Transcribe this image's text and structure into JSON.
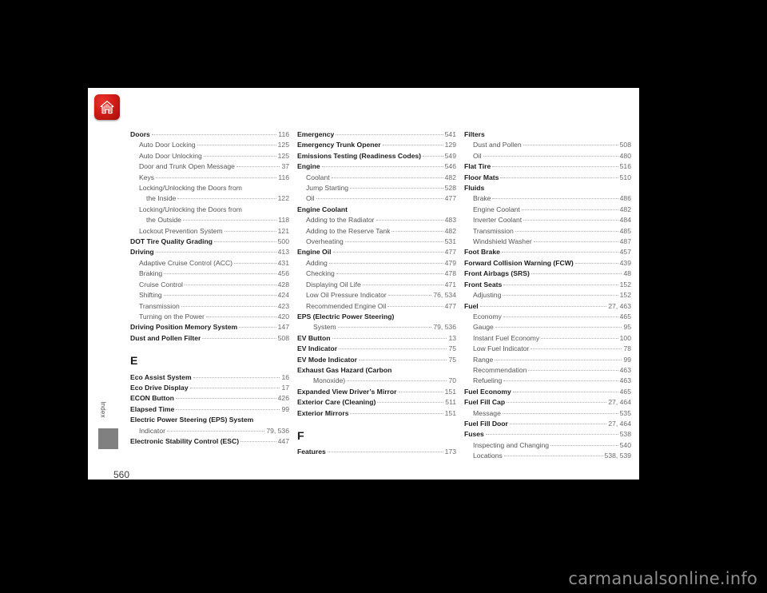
{
  "page": {
    "folio": "560",
    "side_tab_label": "Index",
    "home_icon": "home-icon"
  },
  "watermark": {
    "text": "carmanualsonline.info"
  },
  "columns": [
    {
      "id": "column-1",
      "blocks": [
        {
          "type": "entries",
          "entries": [
            {
              "level": 0,
              "text": "Doors",
              "page": "116"
            },
            {
              "level": 1,
              "text": "Auto Door Locking",
              "page": "125"
            },
            {
              "level": 1,
              "text": "Auto Door Unlocking",
              "page": "125"
            },
            {
              "level": 1,
              "text": "Door and Trunk Open Message",
              "page": "37"
            },
            {
              "level": 1,
              "text": "Keys",
              "page": "116"
            },
            {
              "level": 1,
              "text": "Locking/Unlocking the Doors from",
              "page": ""
            },
            {
              "level": 2,
              "text": "the Inside",
              "page": "122"
            },
            {
              "level": 1,
              "text": "Locking/Unlocking the Doors from",
              "page": ""
            },
            {
              "level": 2,
              "text": "the Outside",
              "page": "118"
            },
            {
              "level": 1,
              "text": "Lockout Prevention System",
              "page": "121"
            },
            {
              "level": 0,
              "text": "DOT Tire Quality Grading",
              "page": "500"
            },
            {
              "level": 0,
              "text": "Driving",
              "page": "413"
            },
            {
              "level": 1,
              "text": "Adaptive Cruise Control (ACC)",
              "page": "431"
            },
            {
              "level": 1,
              "text": "Braking",
              "page": "456"
            },
            {
              "level": 1,
              "text": "Cruise Control",
              "page": "428"
            },
            {
              "level": 1,
              "text": "Shifting",
              "page": "424"
            },
            {
              "level": 1,
              "text": "Transmission",
              "page": "423"
            },
            {
              "level": 1,
              "text": "Turning on the Power",
              "page": "420"
            },
            {
              "level": 0,
              "text": "Driving Position Memory System",
              "page": "147"
            },
            {
              "level": 0,
              "text": "Dust and Pollen Filter",
              "page": "508"
            }
          ]
        },
        {
          "type": "letter",
          "letter": "E",
          "entries": [
            {
              "level": 0,
              "text": "Eco Assist System",
              "page": "16"
            },
            {
              "level": 0,
              "text": "Eco Drive Display",
              "page": "17"
            },
            {
              "level": 0,
              "text": "ECON Button",
              "page": "426"
            },
            {
              "level": 0,
              "text": "Elapsed Time",
              "page": "99"
            },
            {
              "level": 0,
              "text": "Electric Power Steering (EPS) System",
              "page": ""
            },
            {
              "level": 1,
              "text": "Indicator",
              "page": "79, 536"
            },
            {
              "level": 0,
              "text": "Electronic Stability Control (ESC)",
              "page": "447"
            }
          ]
        }
      ]
    },
    {
      "id": "column-2",
      "blocks": [
        {
          "type": "entries",
          "entries": [
            {
              "level": 0,
              "text": "Emergency",
              "page": "541"
            },
            {
              "level": 0,
              "text": "Emergency Trunk Opener",
              "page": "129"
            },
            {
              "level": 0,
              "text": "Emissions Testing (Readiness Codes)",
              "page": "549"
            },
            {
              "level": 0,
              "text": "Engine",
              "page": "546"
            },
            {
              "level": 1,
              "text": "Coolant",
              "page": "482"
            },
            {
              "level": 1,
              "text": "Jump Starting",
              "page": "528"
            },
            {
              "level": 1,
              "text": "Oil",
              "page": "477"
            },
            {
              "level": 0,
              "text": "Engine Coolant",
              "page": ""
            },
            {
              "level": 1,
              "text": "Adding to the Radiator",
              "page": "483"
            },
            {
              "level": 1,
              "text": "Adding to the Reserve Tank",
              "page": "482"
            },
            {
              "level": 1,
              "text": "Overheating",
              "page": "531"
            },
            {
              "level": 0,
              "text": "Engine Oil",
              "page": "477"
            },
            {
              "level": 1,
              "text": "Adding",
              "page": "479"
            },
            {
              "level": 1,
              "text": "Checking",
              "page": "478"
            },
            {
              "level": 1,
              "text": "Displaying Oil Life",
              "page": "471"
            },
            {
              "level": 1,
              "text": "Low Oil Pressure Indicator",
              "page": "76, 534"
            },
            {
              "level": 1,
              "text": "Recommended Engine Oil",
              "page": "477"
            },
            {
              "level": 0,
              "text": "EPS (Electric Power Steering)",
              "page": ""
            },
            {
              "level": 2,
              "text": "System",
              "page": "79, 536"
            },
            {
              "level": 0,
              "text": "EV Button",
              "page": "13"
            },
            {
              "level": 0,
              "text": "EV Indicator",
              "page": "75"
            },
            {
              "level": 0,
              "text": "EV Mode Indicator",
              "page": "75"
            },
            {
              "level": 0,
              "text": "Exhaust Gas Hazard (Carbon",
              "page": ""
            },
            {
              "level": 2,
              "text": "Monoxide)",
              "page": "70"
            },
            {
              "level": 0,
              "text": "Expanded View Driver’s Mirror",
              "page": "151"
            },
            {
              "level": 0,
              "text": "Exterior Care (Cleaning)",
              "page": "511"
            },
            {
              "level": 0,
              "text": "Exterior Mirrors",
              "page": "151"
            }
          ]
        },
        {
          "type": "letter",
          "letter": "F",
          "entries": [
            {
              "level": 0,
              "text": "Features",
              "page": "173"
            }
          ]
        }
      ]
    },
    {
      "id": "column-3",
      "blocks": [
        {
          "type": "entries",
          "entries": [
            {
              "level": 0,
              "text": "Filters",
              "page": ""
            },
            {
              "level": 1,
              "text": "Dust and Pollen",
              "page": "508"
            },
            {
              "level": 1,
              "text": "Oil",
              "page": "480"
            },
            {
              "level": 0,
              "text": "Flat Tire",
              "page": "516"
            },
            {
              "level": 0,
              "text": "Floor Mats",
              "page": "510"
            },
            {
              "level": 0,
              "text": "Fluids",
              "page": ""
            },
            {
              "level": 1,
              "text": "Brake",
              "page": "486"
            },
            {
              "level": 1,
              "text": "Engine Coolant",
              "page": "482"
            },
            {
              "level": 1,
              "text": "Inverter Coolant",
              "page": "484"
            },
            {
              "level": 1,
              "text": "Transmission",
              "page": "485"
            },
            {
              "level": 1,
              "text": "Windshield Washer",
              "page": "487"
            },
            {
              "level": 0,
              "text": "Foot Brake",
              "page": "457"
            },
            {
              "level": 0,
              "text": "Forward Collision Warning (FCW)",
              "page": "439"
            },
            {
              "level": 0,
              "text": "Front Airbags (SRS)",
              "page": "48"
            },
            {
              "level": 0,
              "text": "Front Seats",
              "page": "152"
            },
            {
              "level": 1,
              "text": "Adjusting",
              "page": "152"
            },
            {
              "level": 0,
              "text": "Fuel",
              "page": "27, 463"
            },
            {
              "level": 1,
              "text": "Economy",
              "page": "465"
            },
            {
              "level": 1,
              "text": "Gauge",
              "page": "95"
            },
            {
              "level": 1,
              "text": "Instant Fuel Economy",
              "page": "100"
            },
            {
              "level": 1,
              "text": "Low Fuel Indicator",
              "page": "78"
            },
            {
              "level": 1,
              "text": "Range",
              "page": "99"
            },
            {
              "level": 1,
              "text": "Recommendation",
              "page": "463"
            },
            {
              "level": 1,
              "text": "Refueling",
              "page": "463"
            },
            {
              "level": 0,
              "text": "Fuel Economy",
              "page": "465"
            },
            {
              "level": 0,
              "text": "Fuel Fill Cap",
              "page": "27, 464"
            },
            {
              "level": 1,
              "text": "Message",
              "page": "535"
            },
            {
              "level": 0,
              "text": "Fuel Fill Door",
              "page": "27, 464"
            },
            {
              "level": 0,
              "text": "Fuses",
              "page": "538"
            },
            {
              "level": 1,
              "text": "Inspecting and Changing",
              "page": "540"
            },
            {
              "level": 1,
              "text": "Locations",
              "page": "538, 539"
            }
          ]
        }
      ]
    }
  ]
}
